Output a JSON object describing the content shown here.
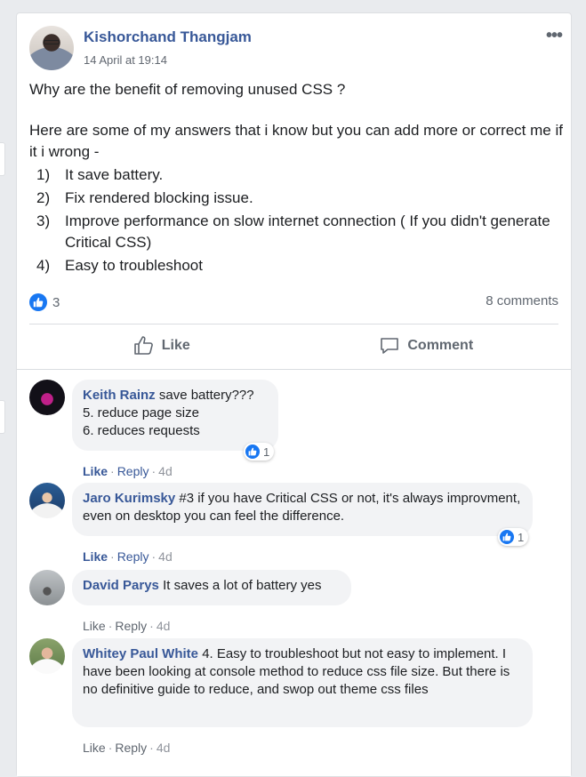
{
  "post": {
    "author": "Kishorchand Thangjam",
    "timestamp": "14 April at 19:14",
    "more_icon": "•••",
    "question": "Why are the benefit of removing unused CSS ?",
    "intro": "Here are some of my answers that i know but you can add more or correct me if it i wrong -",
    "points": [
      {
        "num": "1)",
        "text": "It save battery."
      },
      {
        "num": "2)",
        "text": "Fix rendered blocking issue."
      },
      {
        "num": "3)",
        "text": "Improve performance on slow internet connection ( If you didn't generate Critical CSS)"
      },
      {
        "num": "4)",
        "text": "Easy to troubleshoot"
      }
    ],
    "reaction_count": "3",
    "comment_count": "8 comments"
  },
  "actions": {
    "like": "Like",
    "comment": "Comment"
  },
  "comments": [
    {
      "name": "Keith Rainz",
      "text": "save battery???",
      "extra1": "5. reduce page size",
      "extra2": "6. reduces requests",
      "like": "Like",
      "reply": "Reply",
      "age": "4d",
      "reactions": "1"
    },
    {
      "name": "Jaro Kurimsky",
      "text": "#3 if you have Critical CSS or not, it's always improvment, even on desktop you can feel the difference.",
      "like": "Like",
      "reply": "Reply",
      "age": "4d",
      "reactions": "1"
    },
    {
      "name": "David Parys",
      "text": "It saves a lot of battery yes",
      "like": "Like",
      "reply": "Reply",
      "age": "4d"
    },
    {
      "name": "Whitey Paul White",
      "text": "4. Easy to troubleshoot but not easy to implement. I have been looking at console method to reduce css file size. But there is no definitive guide to reduce, and swop out theme css files",
      "like": "Like",
      "reply": "Reply",
      "age": "4d"
    }
  ],
  "colors": {
    "brand": "#385898",
    "like_blue": "#1877f2",
    "bubble": "#f2f3f5",
    "bg": "#e9ebee"
  }
}
